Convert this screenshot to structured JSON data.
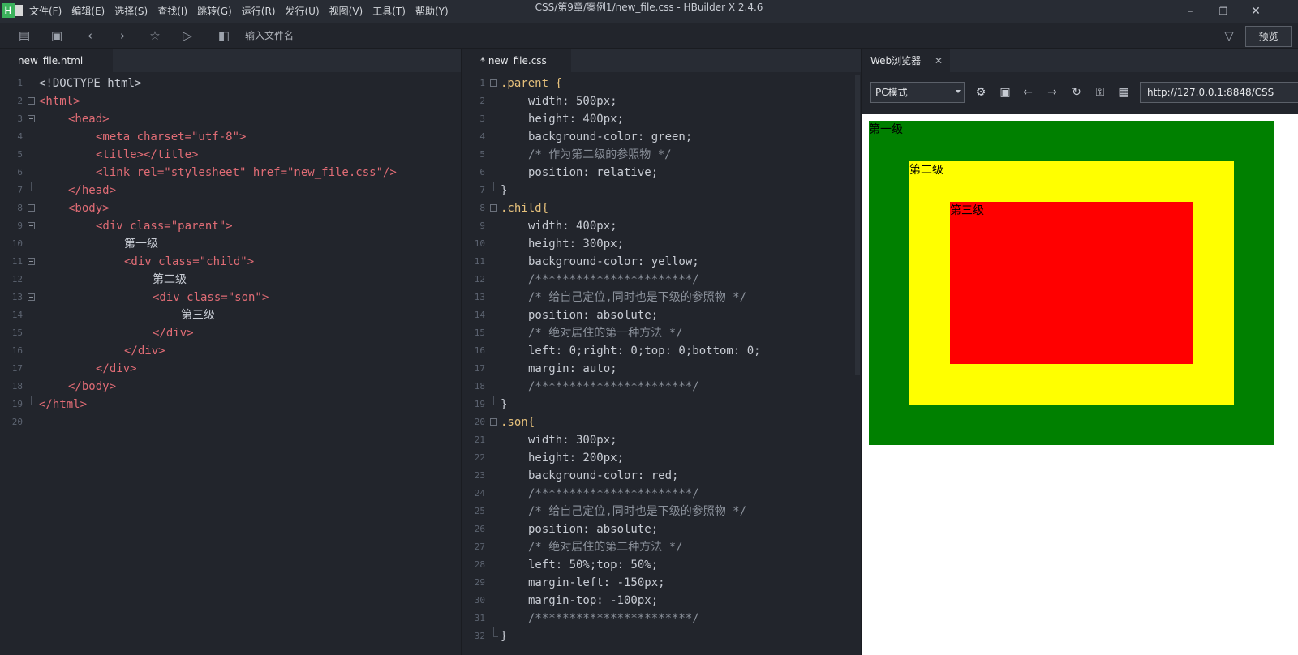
{
  "app": {
    "logo_text": "H",
    "menu": [
      "文件(F)",
      "编辑(E)",
      "选择(S)",
      "查找(I)",
      "跳转(G)",
      "运行(R)",
      "发行(U)",
      "视图(V)",
      "工具(T)",
      "帮助(Y)"
    ],
    "window_title": "CSS/第9章/案例1/new_file.css - HBuilder X 2.4.6"
  },
  "toolbar": {
    "file_search_placeholder": "输入文件名",
    "preview_label": "预览",
    "icons": [
      "new-file-icon",
      "save-icon",
      "back-icon",
      "forward-icon",
      "star-icon",
      "run-icon",
      "find-file-icon",
      "filter-icon"
    ]
  },
  "editor_html": {
    "tab_label": "new_file.html",
    "lines": [
      {
        "n": "1"
      },
      {
        "n": "2"
      },
      {
        "n": "3"
      },
      {
        "n": "4"
      },
      {
        "n": "5"
      },
      {
        "n": "6"
      },
      {
        "n": "7"
      },
      {
        "n": "8"
      },
      {
        "n": "9"
      },
      {
        "n": "10"
      },
      {
        "n": "11"
      },
      {
        "n": "12"
      },
      {
        "n": "13"
      },
      {
        "n": "14"
      },
      {
        "n": "15"
      },
      {
        "n": "16"
      },
      {
        "n": "17"
      },
      {
        "n": "18"
      },
      {
        "n": "19"
      },
      {
        "n": "20"
      }
    ]
  },
  "editor_css": {
    "tab_label": "* new_file.css",
    "lines": [
      {
        "n": "1"
      },
      {
        "n": "2"
      },
      {
        "n": "3"
      },
      {
        "n": "4"
      },
      {
        "n": "5"
      },
      {
        "n": "6"
      },
      {
        "n": "7"
      },
      {
        "n": "8"
      },
      {
        "n": "9"
      },
      {
        "n": "10"
      },
      {
        "n": "11"
      },
      {
        "n": "12"
      },
      {
        "n": "13"
      },
      {
        "n": "14"
      },
      {
        "n": "15"
      },
      {
        "n": "16"
      },
      {
        "n": "17"
      },
      {
        "n": "18"
      },
      {
        "n": "19"
      },
      {
        "n": "20"
      },
      {
        "n": "21"
      },
      {
        "n": "22"
      },
      {
        "n": "23"
      },
      {
        "n": "24"
      },
      {
        "n": "25"
      },
      {
        "n": "26"
      },
      {
        "n": "27"
      },
      {
        "n": "28"
      },
      {
        "n": "29"
      },
      {
        "n": "30"
      },
      {
        "n": "31"
      },
      {
        "n": "32"
      }
    ]
  },
  "browser": {
    "tab_label": "Web浏览器",
    "mode": "PC模式",
    "url": "http://127.0.0.1:8848/CSS",
    "boxes": {
      "parent": {
        "label": "第一级",
        "color": "#008000"
      },
      "child": {
        "label": "第二级",
        "color": "#ffff00"
      },
      "son": {
        "label": "第三级",
        "color": "#ff0000"
      }
    }
  },
  "code_html": [
    "<!DOCTYPE html>",
    "<html>",
    "<head>",
    "<meta charset=\"utf-8\">",
    "<title></title>",
    "<link rel=\"stylesheet\" href=\"new_file.css\"/>",
    "</head>",
    "<body>",
    "<div class=\"parent\">",
    "第一级",
    "<div class=\"child\">",
    "第二级",
    "<div class=\"son\">",
    "第三级",
    "</div>",
    "</div>",
    "</div>",
    "</body>",
    "</html>"
  ],
  "code_css": [
    ".parent {",
    "width: 500px;",
    "height: 400px;",
    "background-color: green;",
    "/* 作为第二级的参照物 */",
    "position: relative;",
    "}",
    ".child{",
    "width: 400px;",
    "height: 300px;",
    "background-color: yellow;",
    "/***********************/",
    "/* 给自己定位,同时也是下级的参照物 */",
    "position: absolute;",
    "/* 绝对居住的第一种方法 */",
    "left: 0;right: 0;top: 0;bottom: 0;",
    "margin: auto;",
    "/***********************/",
    "}",
    ".son{",
    "width: 300px;",
    "height: 200px;",
    "background-color: red;",
    "/***********************/",
    "/* 给自己定位,同时也是下级的参照物 */",
    "position: absolute;",
    "/* 绝对居住的第二种方法 */",
    "left: 50%;top: 50%;",
    "margin-left: -150px;",
    "margin-top: -100px;",
    "/***********************/",
    "}"
  ]
}
